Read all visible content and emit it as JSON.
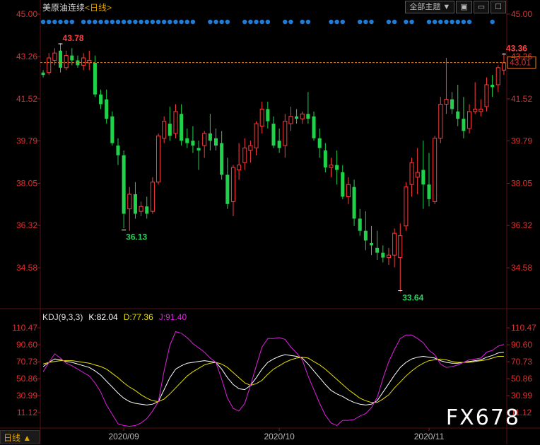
{
  "header": {
    "symbol": "美原油连续",
    "period_link": "<日线>"
  },
  "toolbar": {
    "theme_label": "全部主题",
    "dropdown": "▼",
    "icons": [
      "restore-icon",
      "minimize-icon",
      "maximize-icon",
      "close-icon"
    ]
  },
  "kdj": {
    "name": "KDJ(9,3,3)",
    "k_label": "K:82.04",
    "d_label": "D:77.36",
    "j_label": "J:91.40"
  },
  "footer": {
    "period_label": "日线 ▲",
    "watermark": "FX678"
  },
  "chart_data": [
    {
      "type": "candlestick",
      "title": "美原油连续",
      "period": "日线",
      "ylim": [
        32.9,
        45.0
      ],
      "y_ticks": [
        "45.00",
        "43.26",
        "41.52",
        "39.79",
        "38.05",
        "36.32",
        "34.58"
      ],
      "x_ticks": [
        {
          "label": "2020/09",
          "index": 14
        },
        {
          "label": "2020/10",
          "index": 41
        },
        {
          "label": "2020/11",
          "index": 67
        }
      ],
      "last_price_label": "43.01",
      "last_price": 43.01,
      "annotations": [
        {
          "text": "43.78",
          "index": 3,
          "value": 43.78,
          "color": "#ff4040"
        },
        {
          "text": "36.13",
          "index": 14,
          "value": 36.13,
          "color": "#30d060"
        },
        {
          "text": "33.64",
          "index": 62,
          "value": 33.64,
          "color": "#30d060"
        },
        {
          "text": "43.36",
          "index": 80,
          "value": 43.36,
          "color": "#ff4040"
        }
      ],
      "dot_indices": [
        0,
        1,
        2,
        3,
        4,
        5,
        7,
        8,
        9,
        10,
        11,
        12,
        13,
        14,
        15,
        16,
        17,
        18,
        19,
        20,
        21,
        22,
        23,
        24,
        25,
        26,
        29,
        30,
        31,
        32,
        35,
        36,
        37,
        38,
        39,
        42,
        43,
        45,
        46,
        50,
        51,
        52,
        55,
        56,
        57,
        60,
        61,
        63,
        64,
        67,
        68,
        69,
        70,
        71,
        72,
        73,
        74,
        78
      ],
      "ohlc": [
        [
          42.6,
          42.7,
          42.4,
          42.5
        ],
        [
          42.6,
          43.4,
          42.5,
          43.2
        ],
        [
          43.1,
          43.6,
          42.9,
          43.4
        ],
        [
          43.5,
          43.8,
          42.6,
          42.8
        ],
        [
          42.8,
          43.5,
          42.7,
          43.3
        ],
        [
          43.3,
          43.6,
          42.9,
          43.1
        ],
        [
          43.1,
          43.3,
          42.8,
          42.9
        ],
        [
          42.9,
          43.4,
          42.7,
          43.2
        ],
        [
          43.0,
          43.5,
          42.7,
          43.1
        ],
        [
          43.0,
          43.3,
          41.6,
          41.7
        ],
        [
          41.7,
          41.9,
          41.1,
          41.3
        ],
        [
          41.5,
          41.9,
          40.5,
          40.7
        ],
        [
          40.8,
          41.0,
          39.6,
          39.7
        ],
        [
          39.6,
          39.9,
          38.8,
          39.2
        ],
        [
          39.2,
          39.4,
          36.2,
          36.8
        ],
        [
          37.0,
          37.9,
          36.1,
          37.6
        ],
        [
          37.6,
          38.1,
          36.6,
          36.8
        ],
        [
          36.9,
          37.3,
          36.7,
          37.1
        ],
        [
          37.1,
          37.5,
          36.6,
          36.8
        ],
        [
          36.9,
          38.3,
          36.8,
          38.1
        ],
        [
          38.1,
          40.1,
          38.0,
          40.0
        ],
        [
          39.9,
          40.8,
          39.7,
          40.6
        ],
        [
          40.5,
          41.2,
          39.8,
          40.0
        ],
        [
          40.1,
          41.3,
          39.9,
          41.0
        ],
        [
          40.9,
          41.3,
          39.6,
          39.8
        ],
        [
          39.9,
          40.3,
          39.5,
          39.7
        ],
        [
          39.8,
          40.4,
          39.3,
          39.6
        ],
        [
          39.5,
          39.8,
          38.6,
          39.4
        ],
        [
          39.6,
          40.2,
          39.1,
          40.1
        ],
        [
          40.1,
          40.9,
          39.4,
          39.8
        ],
        [
          39.9,
          40.3,
          39.4,
          39.6
        ],
        [
          39.7,
          40.2,
          38.2,
          38.4
        ],
        [
          38.4,
          39.1,
          37.0,
          37.2
        ],
        [
          37.3,
          38.8,
          36.7,
          38.7
        ],
        [
          38.6,
          39.7,
          38.2,
          38.8
        ],
        [
          38.9,
          39.9,
          38.6,
          39.5
        ],
        [
          39.4,
          39.8,
          38.9,
          39.6
        ],
        [
          39.5,
          40.6,
          39.2,
          40.5
        ],
        [
          40.4,
          41.4,
          40.1,
          41.1
        ],
        [
          41.1,
          41.4,
          40.3,
          40.6
        ],
        [
          40.5,
          40.8,
          39.5,
          39.6
        ],
        [
          39.8,
          40.3,
          39.3,
          39.5
        ],
        [
          39.6,
          40.9,
          39.1,
          40.6
        ],
        [
          40.5,
          41.2,
          40.2,
          40.8
        ],
        [
          40.8,
          41.1,
          40.5,
          40.7
        ],
        [
          40.7,
          41.0,
          40.5,
          40.9
        ],
        [
          40.9,
          41.8,
          40.5,
          40.7
        ],
        [
          40.8,
          41.0,
          39.8,
          39.9
        ],
        [
          39.9,
          40.3,
          39.1,
          39.5
        ],
        [
          39.4,
          39.7,
          38.5,
          38.7
        ],
        [
          38.7,
          39.1,
          38.3,
          38.8
        ],
        [
          38.8,
          39.4,
          38.0,
          38.6
        ],
        [
          38.5,
          38.8,
          37.4,
          37.5
        ],
        [
          37.5,
          38.3,
          37.2,
          38.0
        ],
        [
          37.9,
          38.2,
          36.3,
          36.6
        ],
        [
          36.6,
          37.0,
          35.9,
          36.1
        ],
        [
          36.1,
          36.9,
          35.3,
          35.7
        ],
        [
          35.6,
          36.3,
          35.1,
          35.5
        ],
        [
          35.4,
          36.1,
          34.9,
          35.2
        ],
        [
          35.2,
          35.5,
          34.8,
          35.0
        ],
        [
          35.0,
          35.4,
          34.7,
          35.1
        ],
        [
          35.1,
          36.2,
          34.6,
          36.0
        ],
        [
          35.0,
          36.4,
          33.6,
          35.9
        ],
        [
          36.3,
          38.1,
          36.1,
          37.9
        ],
        [
          38.0,
          39.1,
          37.5,
          38.9
        ],
        [
          38.3,
          39.5,
          37.6,
          38.5
        ],
        [
          38.6,
          39.8,
          37.0,
          38.0
        ],
        [
          38.0,
          39.3,
          37.1,
          37.4
        ],
        [
          37.3,
          40.0,
          37.2,
          39.9
        ],
        [
          39.9,
          41.6,
          39.7,
          41.3
        ],
        [
          41.3,
          43.2,
          40.9,
          41.5
        ],
        [
          41.5,
          41.8,
          40.9,
          41.1
        ],
        [
          41.0,
          42.1,
          40.4,
          40.7
        ],
        [
          40.7,
          41.6,
          39.9,
          40.2
        ],
        [
          40.3,
          41.3,
          40.1,
          41.0
        ],
        [
          41.0,
          42.2,
          40.9,
          41.1
        ],
        [
          41.0,
          41.5,
          40.8,
          41.1
        ],
        [
          41.2,
          42.4,
          41.0,
          42.1
        ],
        [
          42.1,
          42.5,
          41.6,
          42.0
        ],
        [
          42.1,
          42.9,
          41.8,
          42.8
        ],
        [
          42.7,
          43.4,
          42.5,
          43.0
        ]
      ]
    },
    {
      "type": "line",
      "title": "KDJ(9,3,3)",
      "y_ticks": [
        "110.47",
        "90.60",
        "70.73",
        "50.86",
        "30.99",
        "11.12"
      ],
      "ylim": [
        -7,
        118
      ],
      "series": [
        {
          "name": "K",
          "color": "#ffffff",
          "values": [
            65,
            70,
            74,
            73,
            71,
            70,
            68,
            66,
            64,
            60,
            55,
            48,
            41,
            34,
            28,
            24,
            22,
            21,
            20,
            21,
            24,
            38,
            52,
            62,
            66,
            69,
            70,
            71,
            72,
            71,
            70,
            62,
            52,
            44,
            39,
            38,
            43,
            52,
            62,
            70,
            74,
            77,
            79,
            78,
            77,
            75,
            68,
            60,
            52,
            44,
            37,
            33,
            30,
            26,
            23,
            21,
            20,
            21,
            25,
            35,
            45,
            55,
            64,
            70,
            74,
            76,
            77,
            76,
            75,
            72,
            70,
            69,
            69,
            70,
            71,
            72,
            73,
            76,
            78,
            81,
            82
          ]
        },
        {
          "name": "D",
          "color": "#e8e000",
          "values": [
            68,
            70,
            71,
            72,
            72,
            72,
            71,
            70,
            69,
            67,
            65,
            62,
            57,
            52,
            46,
            41,
            37,
            32,
            28,
            25,
            24,
            27,
            33,
            40,
            47,
            54,
            59,
            63,
            67,
            69,
            70,
            68,
            64,
            58,
            52,
            46,
            43,
            45,
            49,
            56,
            62,
            66,
            70,
            73,
            75,
            76,
            75,
            71,
            67,
            62,
            56,
            50,
            44,
            38,
            33,
            28,
            25,
            23,
            23,
            27,
            32,
            40,
            47,
            54,
            60,
            65,
            69,
            72,
            73,
            74,
            73,
            71,
            70,
            70,
            70,
            71,
            72,
            73,
            75,
            77,
            77
          ]
        },
        {
          "name": "J",
          "color": "#e020e0",
          "values": [
            59,
            70,
            80,
            75,
            69,
            66,
            62,
            58,
            54,
            46,
            35,
            20,
            9,
            -2,
            -4,
            -5,
            -4,
            -1,
            4,
            13,
            24,
            60,
            90,
            106,
            104,
            99,
            92,
            87,
            82,
            75,
            70,
            50,
            28,
            16,
            13,
            22,
            43,
            66,
            88,
            98,
            98,
            99,
            97,
            88,
            81,
            73,
            54,
            38,
            22,
            8,
            -1,
            -4,
            2,
            2,
            3,
            7,
            10,
            17,
            29,
            51,
            71,
            85,
            98,
            102,
            102,
            98,
            93,
            84,
            79,
            68,
            64,
            65,
            67,
            70,
            73,
            74,
            75,
            82,
            84,
            89,
            91
          ]
        }
      ]
    }
  ]
}
